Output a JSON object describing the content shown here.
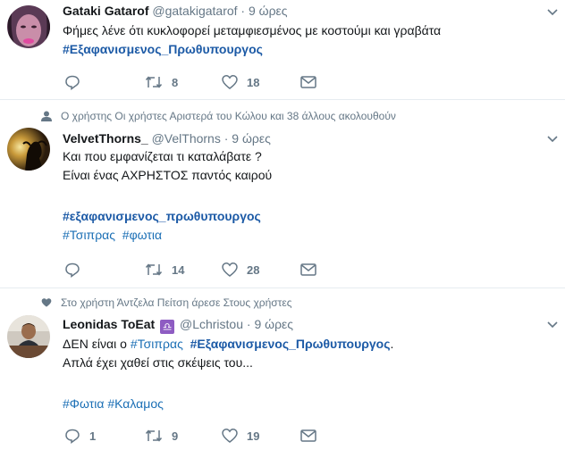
{
  "tweets": [
    {
      "name": "Gataki Gatarof",
      "handle": "@gatakigatarof",
      "dot": "·",
      "time": "9 ώρες",
      "lines": [
        "Φήμες λένε ότι κυκλοφορεί μεταμφιεσμένος με κοστούμι και γραβάτα"
      ],
      "hashtags": [
        "#Εξαφανισμενος_Πρωθυπουργος"
      ],
      "replies": "",
      "retweets": "8",
      "likes": "18"
    },
    {
      "context": "Ο χρήστης Οι χρήστες Αριστερά του Κώλου και 38 άλλους ακολουθούν",
      "name": "VelvetThorns_",
      "handle": "@VelThorns",
      "dot": "·",
      "time": "9 ώρες",
      "lines": [
        "Και που εμφανίζεται τι καταλάβατε ?",
        "Είναι ένας ΑΧΡΗΣΤΟΣ παντός καιρού"
      ],
      "hashtags": [
        "#εξαφανισμενος_πρωθυπουργος",
        "#Τσιπρας",
        "#φωτια"
      ],
      "replies": "",
      "retweets": "14",
      "likes": "28"
    },
    {
      "context": "Στο χρήστη Άντζελα Πείτση άρεσε Στους χρήστες",
      "name": "Leonidas ToEat",
      "badge": "♎",
      "handle": "@Lchristou",
      "dot": "·",
      "time": "9 ώρες",
      "line1_prefix": "ΔΕΝ είναι ο",
      "hashtags": [
        "#Τσιπρας",
        "#Εξαφανισμενος_Πρωθυπουργος",
        "#Φωτια",
        "#Καλαμος"
      ],
      "line1_suffix": ".",
      "line2": "Απλά έχει χαθεί στις σκέψεις του...",
      "replies": "1",
      "retweets": "9",
      "likes": "19"
    }
  ],
  "colors": {
    "hashtag": "#1b6fb5",
    "muted": "#657786",
    "separator": "#e6ecf0"
  }
}
